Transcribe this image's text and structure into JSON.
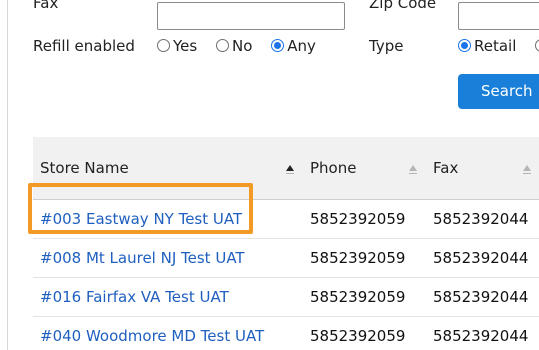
{
  "form": {
    "fax_label": "Fax",
    "zip_label": "Zip Code",
    "refill_label": "Refill enabled",
    "refill_options": [
      "Yes",
      "No",
      "Any"
    ],
    "refill_selected": "Any",
    "type_label": "Type",
    "type_options": [
      "Retail"
    ],
    "type_selected": "Retail",
    "search_button": "Search"
  },
  "table": {
    "headers": {
      "store_name": "Store Name",
      "phone": "Phone",
      "fax": "Fax"
    },
    "sort": {
      "column": "Store Name",
      "direction": "ascending"
    },
    "rows": [
      {
        "store": "#003 Eastway NY Test UAT",
        "phone": "5852392059",
        "fax": "5852392044"
      },
      {
        "store": "#008 Mt Laurel NJ Test UAT",
        "phone": "5852392059",
        "fax": "5852392044"
      },
      {
        "store": "#016 Fairfax VA Test UAT",
        "phone": "5852392059",
        "fax": "5852392044"
      },
      {
        "store": "#040 Woodmore MD Test UAT",
        "phone": "5852392059",
        "fax": "5852392044"
      }
    ]
  },
  "annotation": {
    "highlight_color": "#f39a26",
    "highlighted_row": 0
  },
  "colors": {
    "accent": "#1a7fd9",
    "link": "#1f5fbf",
    "header_bg": "#f1f1f1"
  }
}
